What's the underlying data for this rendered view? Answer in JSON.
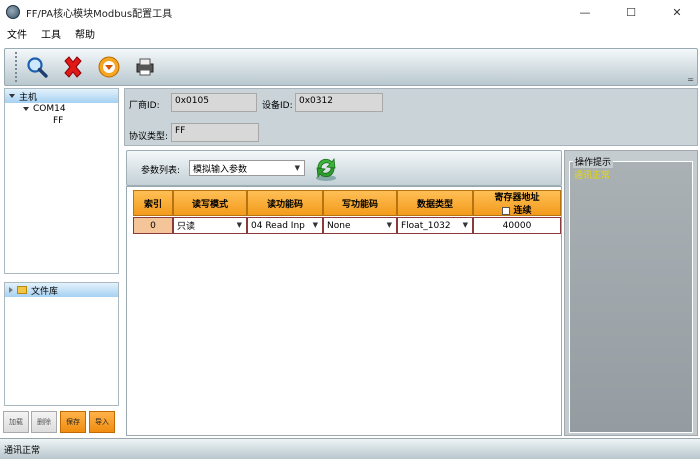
{
  "window": {
    "title": "FF/PA核心模块Modbus配置工具",
    "minimize": "—",
    "maximize": "☐",
    "close": "✕"
  },
  "menu": [
    "文件",
    "工具",
    "帮助"
  ],
  "toolbar": {
    "icons": [
      "search-icon",
      "delete-icon",
      "download-icon",
      "printer-icon"
    ],
    "overflow": "="
  },
  "tree": {
    "root": "主机",
    "port": "COM14",
    "device": "FF"
  },
  "library": {
    "label": "文件库"
  },
  "side_buttons": {
    "load": "加载",
    "delete": "删除",
    "save": "保存",
    "import": "导入"
  },
  "info": {
    "vendor_label": "厂商ID:",
    "vendor_value": "0x0105",
    "device_label": "设备ID:",
    "device_value": "0x0312",
    "protocol_label": "协议类型:",
    "protocol_value": "FF"
  },
  "param": {
    "label": "参数列表:",
    "selected": "模拟输入参数"
  },
  "grid": {
    "headers": {
      "index": "索引",
      "rw_mode": "读写模式",
      "read_fc": "读功能码",
      "write_fc": "写功能码",
      "data_type": "数据类型",
      "register_addr": "寄存器地址",
      "continuous": "连续"
    },
    "rows": [
      {
        "index": "0",
        "rw_mode": "只读",
        "read_fc": "04 Read Inp",
        "write_fc": "None",
        "data_type": "Float_1032",
        "register_addr": "40000"
      }
    ]
  },
  "tips": {
    "title": "操作提示",
    "text": "通讯正常"
  },
  "status": {
    "text": "通讯正常"
  },
  "colors": {
    "header_orange": "#f39b1c",
    "tips_text": "#e8d800",
    "tree_header_blue": "#a6d0f2"
  }
}
